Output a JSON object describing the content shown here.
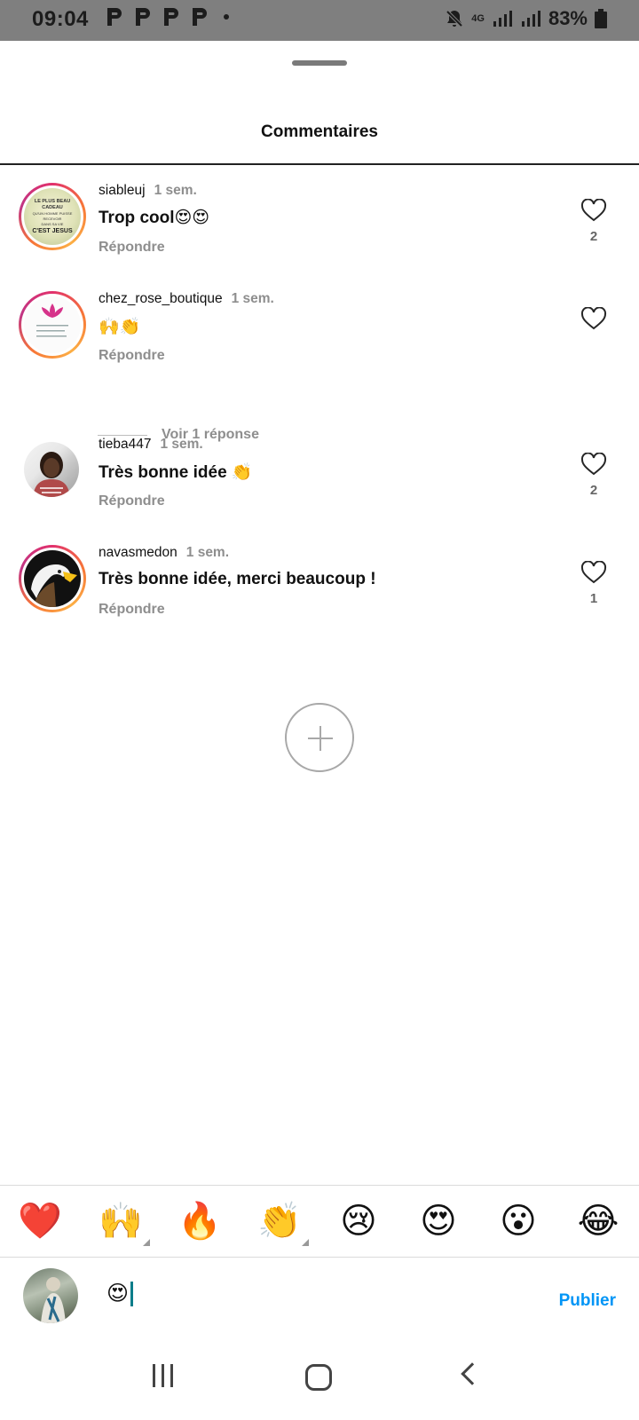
{
  "status_bar": {
    "time": "09:04",
    "notification_icons": [
      "p-icon",
      "p-icon",
      "p-icon",
      "p-icon"
    ],
    "network": "4G",
    "battery": "83%"
  },
  "header": {
    "title": "Commentaires"
  },
  "comments": [
    {
      "username": "siableuj",
      "time": "1 sem.",
      "text": "Trop cool😍😍",
      "reply_label": "Répondre",
      "likes": "2",
      "avatar_text": [
        "LE PLUS BEAU CADEAU",
        "QU'UN HOMME PUISSE RECEVOIR",
        "DANS SA VIE",
        "C'EST JESUS"
      ]
    },
    {
      "username": "chez_rose_boutique",
      "time": "1 sem.",
      "text": "🙌👏",
      "reply_label": "Répondre",
      "likes": "",
      "view_replies": "Voir 1 réponse"
    },
    {
      "username": "tieba447",
      "time": "1 sem.",
      "text": "Très bonne idée 👏",
      "reply_label": "Répondre",
      "likes": "2"
    },
    {
      "username": "navasmedon",
      "time": "1 sem.",
      "text": "Très bonne idée, merci beaucoup !",
      "reply_label": "Répondre",
      "likes": "1"
    }
  ],
  "emoji_bar": [
    "❤️",
    "🙌",
    "🔥",
    "👏",
    "😢",
    "😍",
    "😮",
    "😂"
  ],
  "composer": {
    "value": "😍",
    "publish_label": "Publier"
  },
  "colors": {
    "accent": "#0095f6",
    "story_ring": "#e1306c",
    "muted": "#8e8e8e"
  }
}
